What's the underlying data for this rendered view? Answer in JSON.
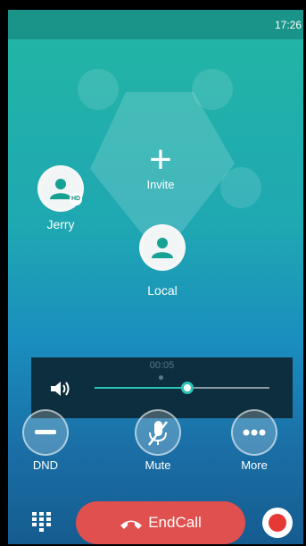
{
  "status": {
    "time": "17:26"
  },
  "conference": {
    "invite_label": "Invite",
    "participants": [
      {
        "name": "Jerry",
        "badge": "HD"
      },
      {
        "name": "Local"
      }
    ]
  },
  "volume": {
    "timer": "00:05",
    "level_percent": 53
  },
  "controls": [
    {
      "label": "DND",
      "icon": "dnd-icon"
    },
    {
      "label": "Mute",
      "icon": "mic-muted-icon"
    },
    {
      "label": "More",
      "icon": "more-icon"
    }
  ],
  "endcall": {
    "label": "EndCall",
    "icon": "hangup-icon"
  },
  "colors": {
    "accent": "#2ec3b7",
    "end_call": "#e0504e",
    "record": "#e53935"
  }
}
